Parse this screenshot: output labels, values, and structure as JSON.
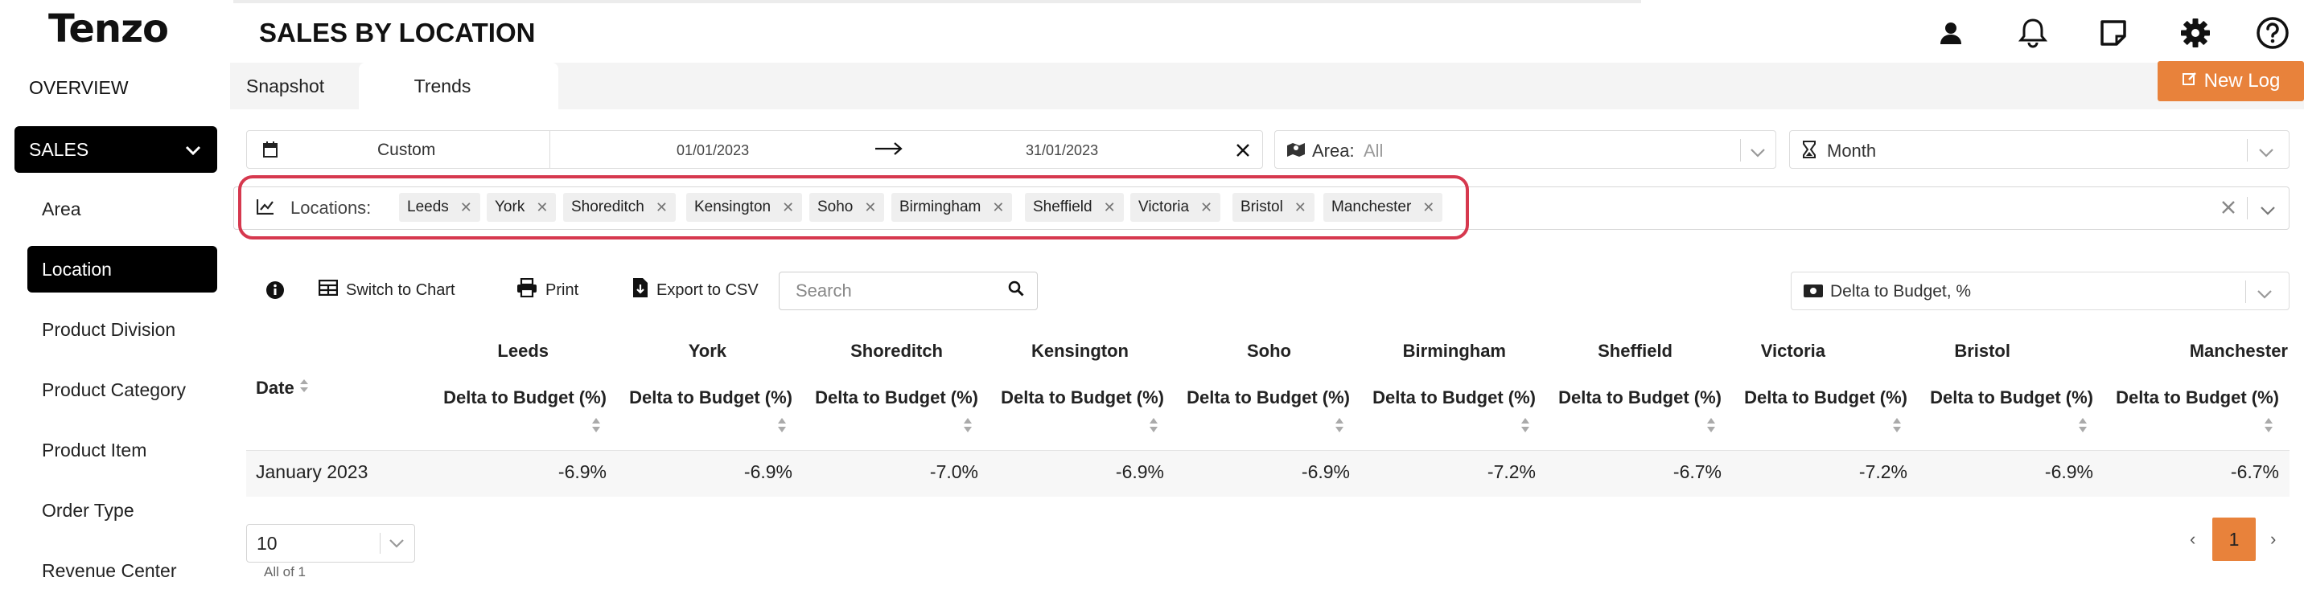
{
  "app": {
    "logo_text": "Tenzo",
    "page_title": "SALES BY LOCATION"
  },
  "header_icons": [
    "user-icon",
    "bell-icon",
    "note-icon",
    "gear-icon",
    "help-icon"
  ],
  "sidebar": {
    "overview": "OVERVIEW",
    "section": "SALES",
    "items": [
      "Area",
      "Location",
      "Product Division",
      "Product Category",
      "Product Item",
      "Order Type",
      "Revenue Center"
    ],
    "active_item": "Location"
  },
  "tabs": [
    "Snapshot",
    "Trends"
  ],
  "active_tab": "Trends",
  "new_log_label": "New Log",
  "filters": {
    "date_preset": "Custom",
    "date_start": "01/01/2023",
    "date_end": "31/01/2023",
    "area_label": "Area:",
    "area_value": "All",
    "period": "Month",
    "locations_label": "Locations:",
    "locations": [
      "Leeds",
      "York",
      "Shoreditch",
      "Kensington",
      "Soho",
      "Birmingham",
      "Sheffield",
      "Victoria",
      "Bristol",
      "Manchester"
    ]
  },
  "toolbar": {
    "switch_label": "Switch to Chart",
    "print_label": "Print",
    "export_label": "Export to CSV",
    "search_placeholder": "Search",
    "metric": "Delta to Budget, %"
  },
  "table": {
    "date_header": "Date",
    "metric_header": "Delta to Budget (%)",
    "columns": [
      "Leeds",
      "York",
      "Shoreditch",
      "Kensington",
      "Soho",
      "Birmingham",
      "Sheffield",
      "Victoria",
      "Bristol",
      "Manchester"
    ],
    "rows": [
      {
        "date": "January 2023",
        "values": [
          "-6.9%",
          "-6.9%",
          "-7.0%",
          "-6.9%",
          "-6.9%",
          "-7.2%",
          "-6.7%",
          "-7.2%",
          "-6.9%",
          "-6.7%"
        ]
      }
    ]
  },
  "pagination": {
    "page_size": "10",
    "summary": "All of 1",
    "prev": "‹",
    "next": "›",
    "current_page": "1"
  },
  "colors": {
    "accent": "#e8823b",
    "highlight": "#d6384e",
    "sidebar_active": "#000000"
  }
}
